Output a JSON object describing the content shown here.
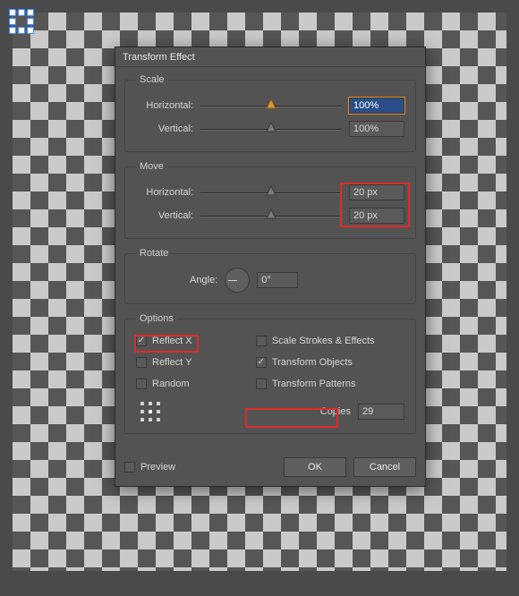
{
  "dialog": {
    "title": "Transform Effect"
  },
  "scale": {
    "legend": "Scale",
    "horizontal_label": "Horizontal:",
    "horizontal_value": "100%",
    "vertical_label": "Vertical:",
    "vertical_value": "100%"
  },
  "move": {
    "legend": "Move",
    "horizontal_label": "Horizontal:",
    "horizontal_value": "20 px",
    "vertical_label": "Vertical:",
    "vertical_value": "20 px"
  },
  "rotate": {
    "legend": "Rotate",
    "angle_label": "Angle:",
    "angle_value": "0°"
  },
  "options": {
    "legend": "Options",
    "reflect_x": "Reflect X",
    "reflect_y": "Reflect Y",
    "random": "Random",
    "scale_strokes": "Scale Strokes & Effects",
    "transform_objects": "Transform Objects",
    "transform_patterns": "Transform Patterns",
    "checked": {
      "reflect_x": true,
      "reflect_y": false,
      "random": false,
      "scale_strokes": false,
      "transform_objects": true,
      "transform_patterns": false
    },
    "copies_label": "Copies",
    "copies_value": "29"
  },
  "footer": {
    "preview_label": "Preview",
    "preview_checked": false,
    "ok": "OK",
    "cancel": "Cancel"
  }
}
